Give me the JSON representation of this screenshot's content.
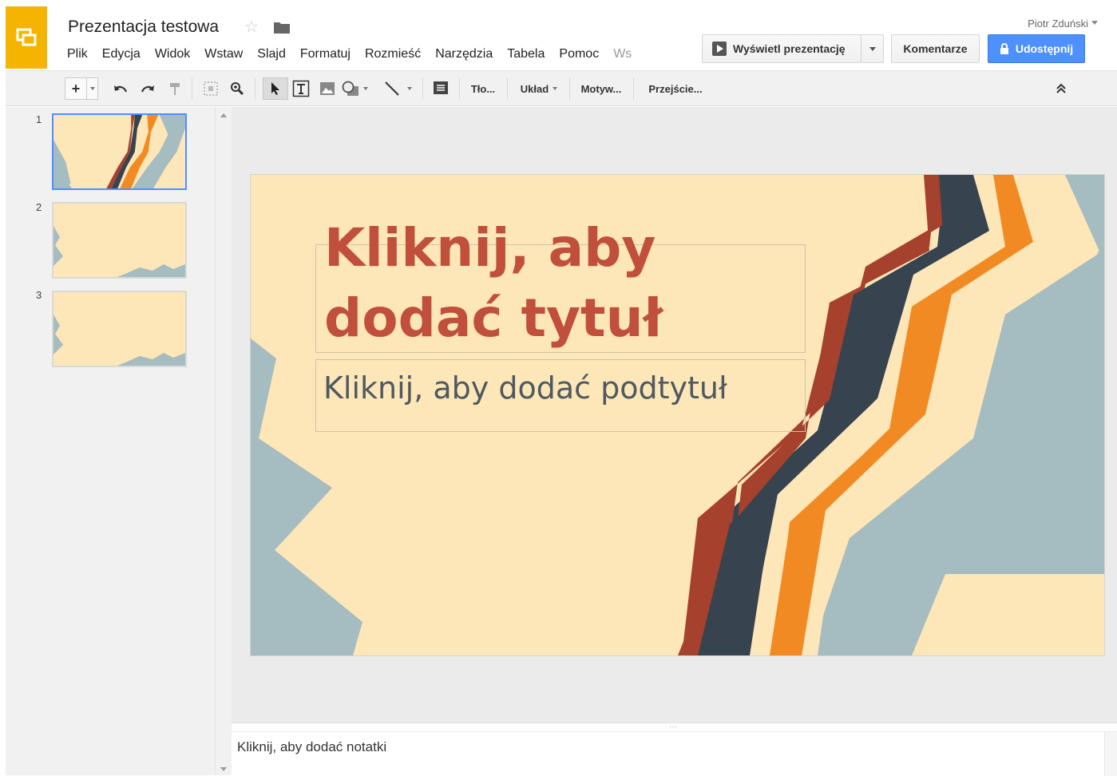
{
  "header": {
    "title": "Prezentacja testowa",
    "user_name": "Piotr Zduński",
    "menu": [
      "Plik",
      "Edycja",
      "Widok",
      "Wstaw",
      "Slajd",
      "Formatuj",
      "Rozmieść",
      "Narzędzia",
      "Tabela",
      "Pomoc",
      "Ws"
    ],
    "present_label": "Wyświetl prezentację",
    "comments_label": "Komentarze",
    "share_label": "Udostępnij"
  },
  "toolbar": {
    "background_label": "Tło...",
    "layout_label": "Układ",
    "theme_label": "Motyw...",
    "transition_label": "Przejście..."
  },
  "filmstrip": {
    "slides": [
      {
        "number": "1"
      },
      {
        "number": "2"
      },
      {
        "number": "3"
      }
    ],
    "selected": 1
  },
  "slide": {
    "title_placeholder": "Kliknij, aby dodać tytuł",
    "subtitle_placeholder": "Kliknij, aby dodać podtytuł"
  },
  "notes": {
    "placeholder": "Kliknij, aby dodać notatki"
  },
  "colors": {
    "logo": "#f4b400",
    "share": "#4d90fe",
    "slide_background": "#fde6b8",
    "title_text": "#c0503b",
    "stripe_red": "#a5412d",
    "stripe_dark": "#37434f",
    "stripe_orange": "#f28a24",
    "stripe_gray": "#a5bcc0"
  }
}
